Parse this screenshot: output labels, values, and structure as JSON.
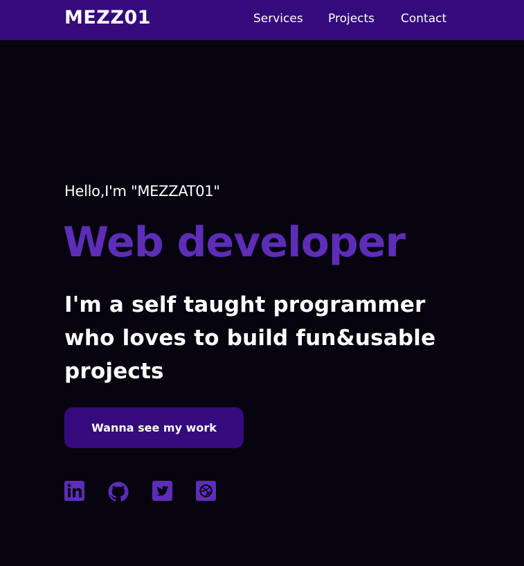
{
  "nav": {
    "logo": "MEZZ01",
    "links": [
      "Services",
      "Projects",
      "Contact"
    ]
  },
  "hero": {
    "greeting": "Hello,I'm \"MEZZAT01\"",
    "role": "Web developer",
    "tagline": "I'm a self taught programmer who loves to build fun&usable projects",
    "cta": "Wanna see my work"
  },
  "socials": [
    "linkedin-icon",
    "github-icon",
    "twitter-icon",
    "dribbble-icon"
  ],
  "colors": {
    "background": "#070410",
    "navbar": "#340a7c",
    "accent": "#5d2db7",
    "text": "#ffffff"
  }
}
